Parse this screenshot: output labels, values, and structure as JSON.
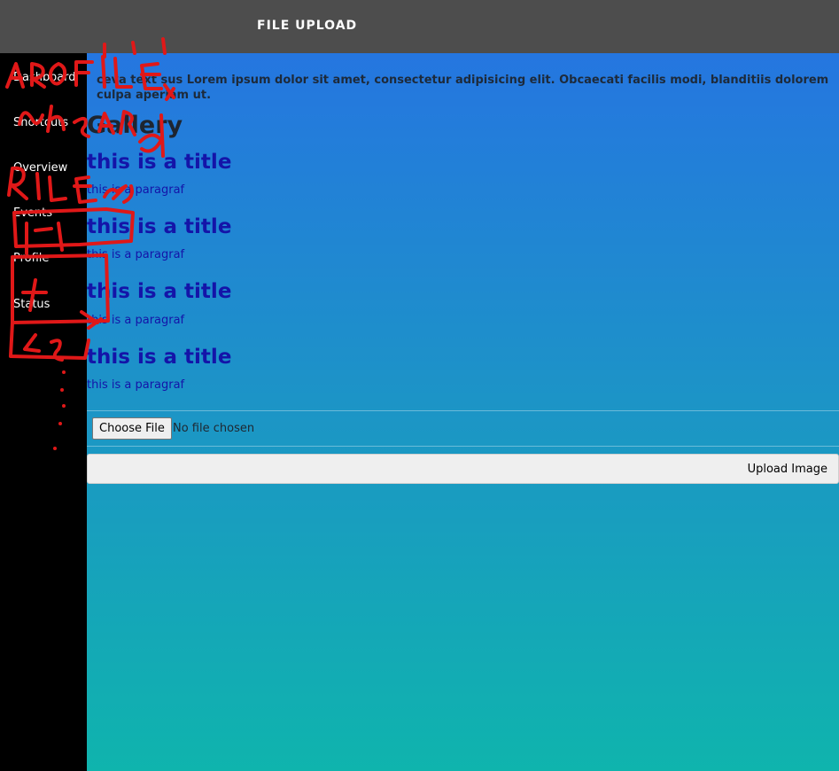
{
  "header": {
    "title": "FILE UPLOAD"
  },
  "sidebar": {
    "items": [
      {
        "label": "Dashboard"
      },
      {
        "label": "Shortcuts"
      },
      {
        "label": "Overview"
      },
      {
        "label": "Events"
      },
      {
        "label": "Profile"
      },
      {
        "label": "Status"
      }
    ]
  },
  "main": {
    "intro": "ceva text sus Lorem ipsum dolor sit amet, consectetur adipisicing elit. Obcaecati facilis modi, blanditiis dolorem culpa aperiam ut.",
    "gallery_title": "Gallery",
    "cards": [
      {
        "title": "this is a title",
        "text": "this is a paragraf"
      },
      {
        "title": "this is a title",
        "text": "this is a paragraf"
      },
      {
        "title": "this is a title",
        "text": "this is a paragraf"
      },
      {
        "title": "this is a title",
        "text": "this is a paragraf"
      }
    ],
    "file_input": {
      "button_label": "Choose File",
      "status": "No file chosen"
    },
    "upload_button_label": "Upload Image"
  },
  "colors": {
    "topbar": "#4d4d4d",
    "sidebar": "#000000",
    "gradient_top": "#2576e0",
    "gradient_bottom": "#0fb4ad",
    "card_text": "#1414a8",
    "annotation": "#e01818"
  }
}
